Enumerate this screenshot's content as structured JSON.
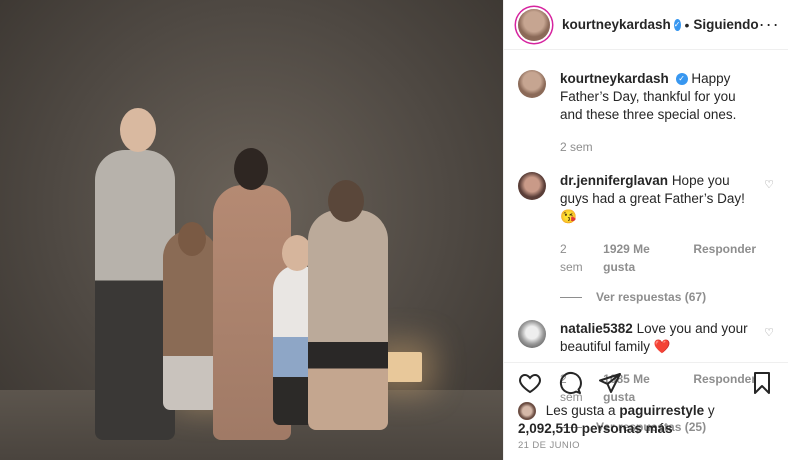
{
  "post": {
    "username": "kourtneykardash",
    "dot": "•",
    "follow_label": "Siguiendo",
    "more": "···",
    "verified_mark": "✓"
  },
  "caption": {
    "username": "kourtneykardash",
    "text": "Happy Father’s Day, thankful for you and these three special ones.",
    "time": "2 sem"
  },
  "comments": [
    {
      "username": "dr.jenniferglavan",
      "text": "Hope you guys had a great Father’s Day! 😘",
      "time": "2 sem",
      "likes": "1929 Me gusta",
      "reply": "Responder",
      "view_replies": "Ver respuestas (67)"
    },
    {
      "username": "natalie5382",
      "text": "Love you and your beautiful family ❤️",
      "time": "2 sem",
      "likes": "1085 Me gusta",
      "reply": "Responder",
      "view_replies": "Ver respuestas (25)"
    }
  ],
  "likes": {
    "prefix": "Les gusta a",
    "user": "paguirrestyle",
    "and": "y",
    "count": "2,092,510 personas más"
  },
  "date": "21 DE JUNIO",
  "icons": [
    "heart-icon",
    "comment-icon",
    "share-icon",
    "bookmark-icon"
  ]
}
